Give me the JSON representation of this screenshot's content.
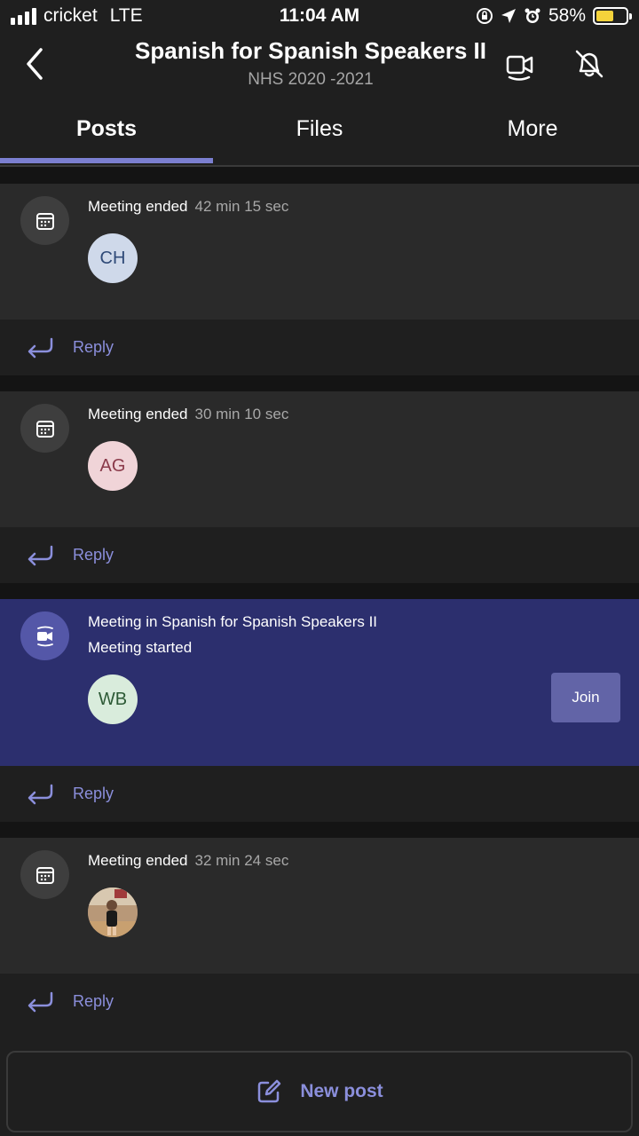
{
  "status_bar": {
    "carrier": "cricket",
    "network": "LTE",
    "time": "11:04 AM",
    "battery": "58%",
    "battery_level": 0.58,
    "battery_color": "#f5d33b"
  },
  "header": {
    "title": "Spanish for Spanish Speakers II",
    "subtitle": "NHS 2020 -2021",
    "icons": [
      "back-icon",
      "video-call-icon",
      "notifications-off-icon"
    ]
  },
  "tabs": [
    {
      "label": "Posts",
      "active": true
    },
    {
      "label": "Files",
      "active": false
    },
    {
      "label": "More",
      "active": false
    }
  ],
  "accent_color": "#6264a7",
  "posts": [
    {
      "title": "Meeting ended",
      "duration": "42 min 15 sec",
      "avatar": "CH",
      "icon": "calendar-icon",
      "reply": "Reply"
    },
    {
      "title": "Meeting ended",
      "duration": "30 min 10 sec",
      "avatar": "AG",
      "icon": "calendar-icon",
      "reply": "Reply"
    },
    {
      "title": "Meeting in Spanish for Spanish Speakers II",
      "status": "Meeting started",
      "avatar": "WB",
      "icon": "video-call-icon",
      "join": "Join",
      "reply": "Reply"
    },
    {
      "title": "Meeting ended",
      "duration": "32 min 24 sec",
      "avatar": "photo",
      "icon": "calendar-icon",
      "reply": "Reply"
    }
  ],
  "new_post": {
    "label": "New post",
    "icon": "compose-icon"
  }
}
